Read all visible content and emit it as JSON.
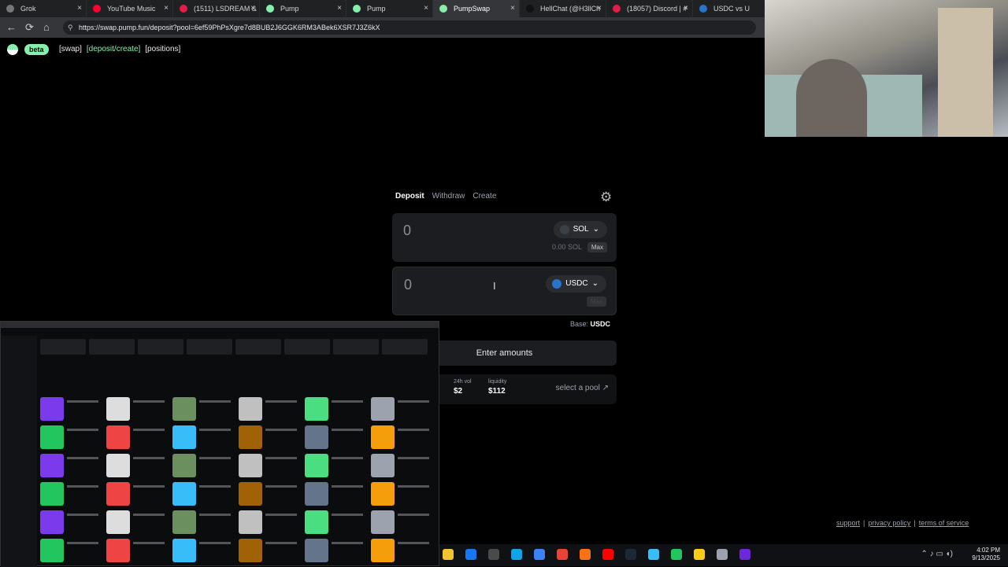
{
  "browser": {
    "tabs": [
      {
        "label": "Grok",
        "color": "#777777",
        "active": false
      },
      {
        "label": "YouTube Music",
        "color": "#ff0033",
        "active": false
      },
      {
        "label": "(1511) LSDREAM &",
        "color": "#e11d48",
        "active": false
      },
      {
        "label": "Pump",
        "color": "#86efac",
        "active": false
      },
      {
        "label": "Pump",
        "color": "#86efac",
        "active": false
      },
      {
        "label": "PumpSwap",
        "color": "#86efac",
        "active": true
      },
      {
        "label": "HellChat (@H3llCh",
        "color": "#111111",
        "active": false
      },
      {
        "label": "(18057) Discord | #",
        "color": "#e11d48",
        "active": false
      },
      {
        "label": "USDC vs U",
        "color": "#2775ca",
        "active": false
      }
    ],
    "url": "https://swap.pump.fun/deposit?pool=6ef59PhPsXgre7d8BUB2J6GGK6RM3ABek6XSR7J3Z6kX"
  },
  "header": {
    "beta": "beta",
    "links": [
      "[swap]",
      "[deposit/create]",
      "[positions]"
    ]
  },
  "panel": {
    "tabs": [
      "Deposit",
      "Withdraw",
      "Create"
    ],
    "input1": {
      "amount": "0",
      "token": "SOL",
      "balance": "0.00 SOL",
      "max": "Max"
    },
    "input2": {
      "amount": "0",
      "token": "USDC",
      "max": "Max"
    },
    "base_label": "Base:",
    "base_token": "USDC",
    "action": "Enter amounts",
    "pool": {
      "vol_label": "24h vol",
      "vol": "$2",
      "liq_label": "liquidity",
      "liq": "$112",
      "select": "select a pool"
    }
  },
  "footer": {
    "links": [
      "support",
      "privacy policy",
      "terms of service"
    ],
    "sep": "|"
  },
  "taskbar": {
    "time": "4:02 PM",
    "date": "9/13/2025"
  }
}
